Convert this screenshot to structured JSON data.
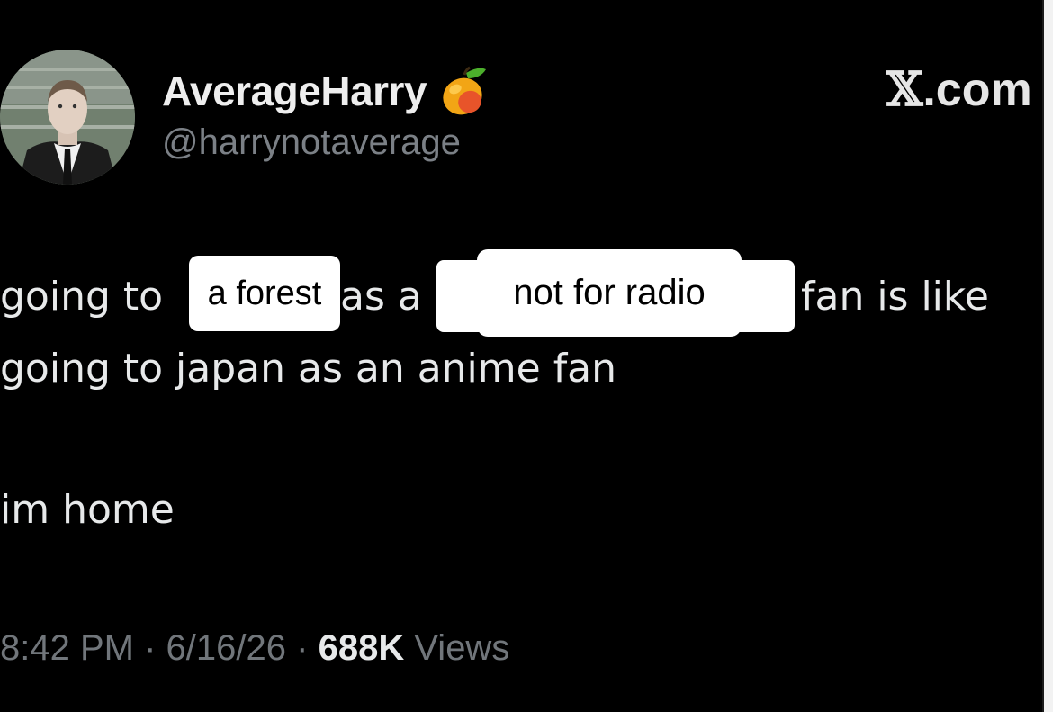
{
  "author": {
    "display_name": "AverageHarry",
    "handle": "@harrynotaverage",
    "badge_icon": "mango-emoji-icon"
  },
  "site_mark": {
    "x_letter": "𝕏",
    "suffix": ".com"
  },
  "tweet": {
    "line1": {
      "going_to": "going to",
      "as_a": "as a",
      "fan_is_like": "fan is like"
    },
    "line2": "going to japan as an anime fan",
    "line3": "im home"
  },
  "stickers": {
    "forest": "a forest",
    "radio": "not for radio"
  },
  "meta": {
    "time": "8:42 PM",
    "date": "6/16/26",
    "separator": "·",
    "views_count": "688K",
    "views_label": "Views"
  },
  "colors": {
    "background": "#000000",
    "text": "#e7e9ea",
    "muted": "#71767b",
    "sticker": "#ffffff"
  }
}
